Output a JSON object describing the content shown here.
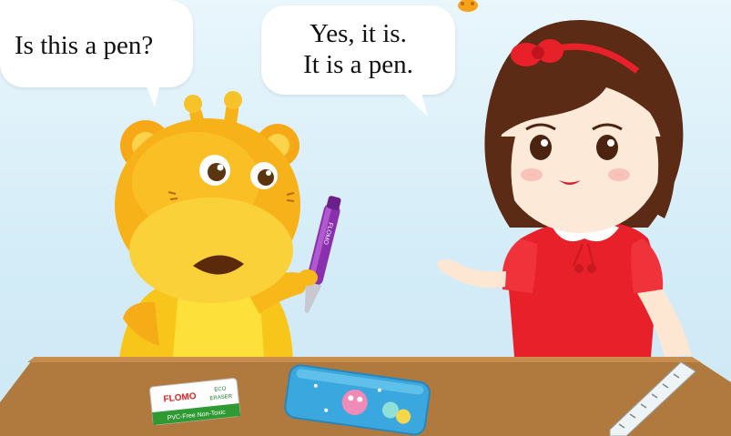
{
  "bubbles": {
    "question": "Is this a pen?",
    "answer_line1": "Yes, it is.",
    "answer_line2": "It is a pen."
  },
  "pen": {
    "brand": "FLOMO"
  },
  "eraser": {
    "brand": "FLOMO",
    "eco": "ECO",
    "type": "ERASER",
    "tagline": "PVC-Free Non-Toxic"
  },
  "colors": {
    "sky": "#dff1f9",
    "giraffe": "#f7b21a",
    "dress": "#e8202a",
    "desk": "#b07a3f",
    "pen": "#8a2fae"
  }
}
